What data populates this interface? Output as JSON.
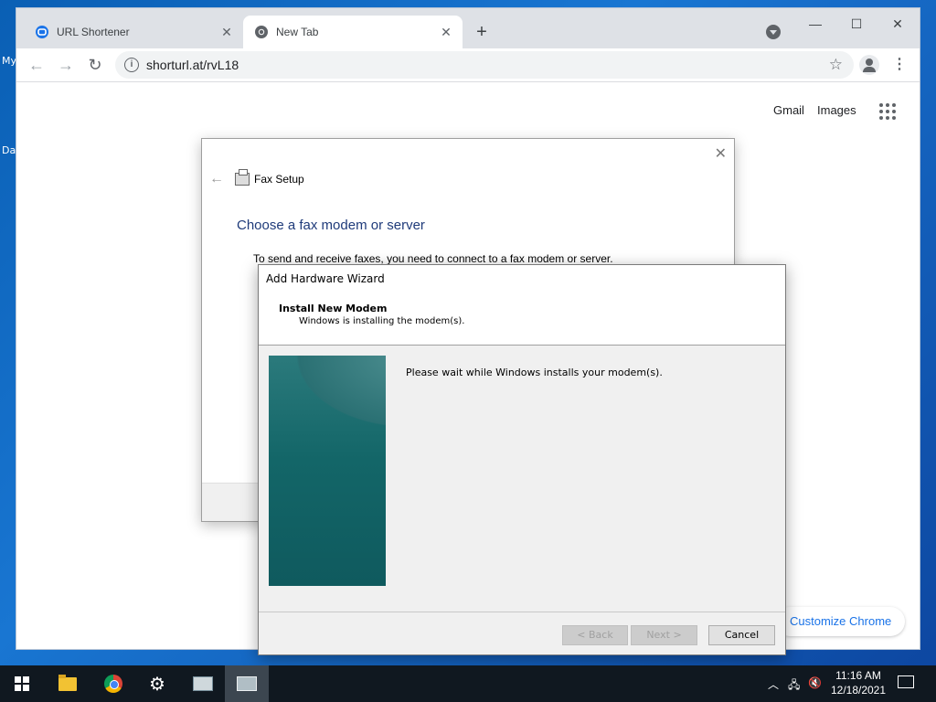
{
  "desktop": {
    "labels": [
      "My",
      "Da"
    ]
  },
  "browser": {
    "tabs": [
      {
        "title": "URL Shortener",
        "favicon": "url-shortener-icon",
        "active": false
      },
      {
        "title": "New Tab",
        "favicon": "chrome-icon",
        "active": true
      }
    ],
    "new_tab_symbol": "+",
    "address": "shorturl.at/rvL18",
    "ntp": {
      "gmail": "Gmail",
      "images": "Images",
      "customize": "Customize Chrome"
    }
  },
  "fax_dialog": {
    "title": "Fax Setup",
    "heading": "Choose a fax modem or server",
    "description": "To send and receive faxes, you need to connect to a fax modem or server."
  },
  "wizard": {
    "title": "Add Hardware Wizard",
    "header_title": "Install New Modem",
    "header_subtitle": "Windows is installing the modem(s).",
    "message": "Please wait while Windows installs your modem(s).",
    "buttons": {
      "back": "< Back",
      "next": "Next >",
      "cancel": "Cancel"
    }
  },
  "taskbar": {
    "time": "11:16 AM",
    "date": "12/18/2021"
  }
}
